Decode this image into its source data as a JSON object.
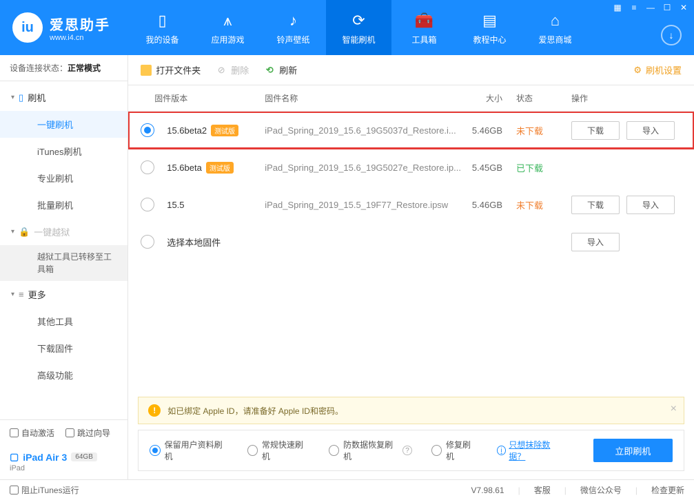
{
  "app": {
    "title": "爱思助手",
    "subtitle": "www.i4.cn"
  },
  "nav": {
    "items": [
      {
        "label": "我的设备"
      },
      {
        "label": "应用游戏"
      },
      {
        "label": "铃声壁纸"
      },
      {
        "label": "智能刷机"
      },
      {
        "label": "工具箱"
      },
      {
        "label": "教程中心"
      },
      {
        "label": "爱思商城"
      }
    ]
  },
  "sidebar": {
    "conn_label": "设备连接状态：",
    "conn_value": "正常模式",
    "cat_flash": "刷机",
    "subs_flash": [
      "一键刷机",
      "iTunes刷机",
      "专业刷机",
      "批量刷机"
    ],
    "cat_jb": "一键越狱",
    "jb_note": "越狱工具已转移至工具箱",
    "cat_more": "更多",
    "subs_more": [
      "其他工具",
      "下载固件",
      "高级功能"
    ],
    "auto_activate": "自动激活",
    "skip_guide": "跳过向导",
    "device_name": "iPad Air 3",
    "device_cap": "64GB",
    "device_type": "iPad"
  },
  "toolbar": {
    "open_folder": "打开文件夹",
    "delete": "删除",
    "refresh": "刷新",
    "settings": "刷机设置"
  },
  "table": {
    "h_version": "固件版本",
    "h_name": "固件名称",
    "h_size": "大小",
    "h_status": "状态",
    "h_ops": "操作",
    "badge_beta": "测试版",
    "btn_download": "下载",
    "btn_import": "导入",
    "local_label": "选择本地固件",
    "rows": [
      {
        "ver": "15.6beta2",
        "beta": true,
        "name": "iPad_Spring_2019_15.6_19G5037d_Restore.i...",
        "size": "5.46GB",
        "status": "未下载",
        "status_class": "st-not",
        "selected": true,
        "highlight": true,
        "show_ops": true
      },
      {
        "ver": "15.6beta",
        "beta": true,
        "name": "iPad_Spring_2019_15.6_19G5027e_Restore.ip...",
        "size": "5.45GB",
        "status": "已下载",
        "status_class": "st-done",
        "selected": false,
        "highlight": false,
        "show_ops": false
      },
      {
        "ver": "15.5",
        "beta": false,
        "name": "iPad_Spring_2019_15.5_19F77_Restore.ipsw",
        "size": "5.46GB",
        "status": "未下载",
        "status_class": "st-not",
        "selected": false,
        "highlight": false,
        "show_ops": true
      }
    ]
  },
  "info": {
    "text": "如已绑定 Apple ID，请准备好 Apple ID和密码。"
  },
  "opts": {
    "items": [
      "保留用户资料刷机",
      "常规快速刷机",
      "防数据恢复刷机",
      "修复刷机"
    ],
    "erase_link": "只想抹除数据？",
    "flash_btn": "立即刷机"
  },
  "footer": {
    "stop_itunes": "阻止iTunes运行",
    "version": "V7.98.61",
    "cs": "客服",
    "wechat": "微信公众号",
    "update": "检查更新"
  }
}
